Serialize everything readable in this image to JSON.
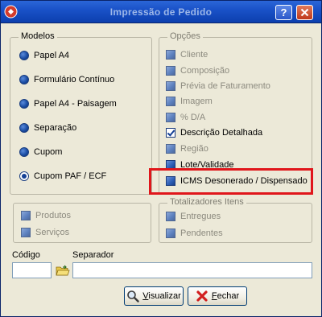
{
  "window": {
    "title": "Impressão de Pedido",
    "help_label": "?"
  },
  "modelos": {
    "legend": "Modelos",
    "items": [
      {
        "label": "Papel A4",
        "selected": false
      },
      {
        "label": "Formulário Contínuo",
        "selected": false
      },
      {
        "label": "Papel A4 - Paisagem",
        "selected": false
      },
      {
        "label": "Separação",
        "selected": false
      },
      {
        "label": "Cupom",
        "selected": false
      },
      {
        "label": "Cupom PAF / ECF",
        "selected": true
      }
    ]
  },
  "opcoes": {
    "legend": "Opções",
    "items": [
      {
        "label": "Cliente",
        "enabled": false,
        "checked": false
      },
      {
        "label": "Composição",
        "enabled": false,
        "checked": false
      },
      {
        "label": "Prévia de Faturamento",
        "enabled": false,
        "checked": false
      },
      {
        "label": "Imagem",
        "enabled": false,
        "checked": false
      },
      {
        "label": "% D/A",
        "enabled": false,
        "checked": false
      },
      {
        "label": "Descrição Detalhada",
        "enabled": true,
        "checked": true
      },
      {
        "label": "Região",
        "enabled": false,
        "checked": false
      },
      {
        "label": "Lote/Validade",
        "enabled": true,
        "checked": false
      },
      {
        "label": "ICMS Desonerado / Dispensado",
        "enabled": true,
        "checked": false
      }
    ]
  },
  "tipos": {
    "items": [
      {
        "label": "Produtos"
      },
      {
        "label": "Serviços"
      }
    ]
  },
  "totalizadores": {
    "legend": "Totalizadores Itens",
    "items": [
      {
        "label": "Entregues"
      },
      {
        "label": "Pendentes"
      }
    ]
  },
  "codigo": {
    "label": "Código",
    "value": ""
  },
  "separador": {
    "label": "Separador",
    "value": ""
  },
  "buttons": {
    "visualizar": {
      "hotkey": "V",
      "rest": "isualizar"
    },
    "fechar": {
      "hotkey": "F",
      "rest": "echar"
    }
  },
  "colors": {
    "highlight": "#e0161b",
    "title_bar": "#1a52c8"
  }
}
